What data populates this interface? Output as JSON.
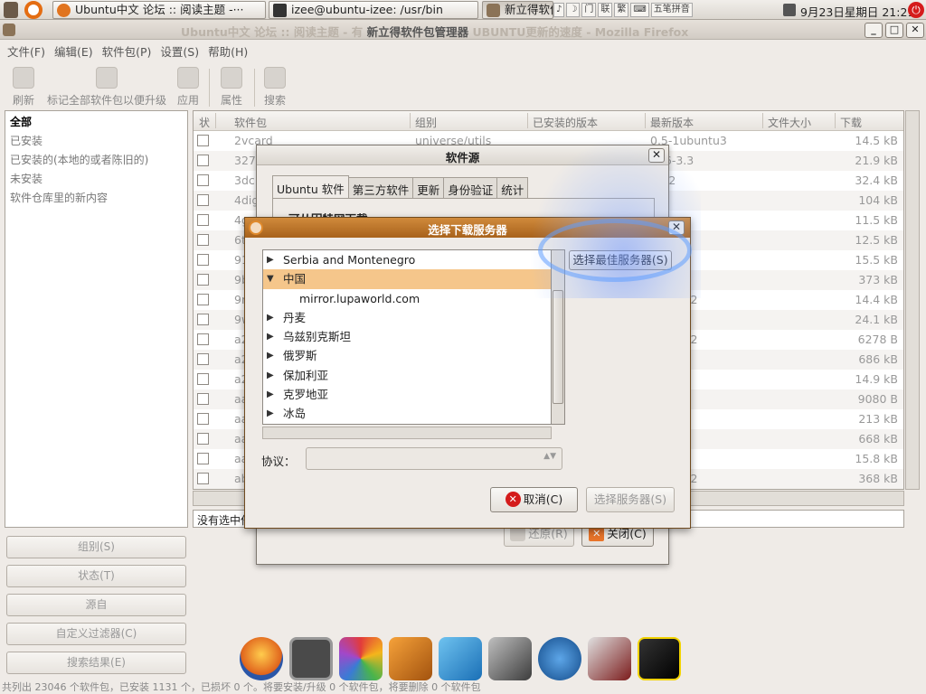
{
  "panel": {
    "tasks": [
      {
        "label": "Ubuntu中文 论坛 :: 阅读主题 -···"
      },
      {
        "label": "izee@ubuntu-izee: /usr/bin"
      },
      {
        "label": "新立得软件"
      }
    ],
    "tray": [
      "♪",
      "☽",
      "门",
      "联",
      "繁",
      "⌨",
      "五笔拼音"
    ],
    "clock": "9月23日星期日 21:21"
  },
  "window": {
    "title_faded_left": "Ubuntu中文 论坛 :: 阅读主题 - 有",
    "title": "新立得软件包管理器",
    "title_faded_right": "UBUNTU更新的速度 - Mozilla Firefox",
    "controls": [
      "_",
      "□",
      "✕"
    ]
  },
  "menubar": [
    "文件(F)",
    "编辑(E)",
    "软件包(P)",
    "设置(S)",
    "帮助(H)"
  ],
  "toolbar": {
    "reload": "刷新",
    "mark_all": "标记全部软件包以便升级",
    "apply": "应用",
    "properties": "属性",
    "search": "搜索"
  },
  "filters": [
    "全部",
    "已安装",
    "已安装的(本地的或者陈旧的)",
    "未安装",
    "软件仓库里的新内容"
  ],
  "side_buttons": [
    "组别(S)",
    "状态(T)",
    "源自",
    "自定义过滤器(C)",
    "搜索结果(E)"
  ],
  "table": {
    "columns": [
      "状",
      "软件包",
      "组别",
      "已安装的版本",
      "最新版本",
      "文件大小",
      "下载"
    ],
    "rows": [
      {
        "pkg": "2vcard",
        "group": "universe/utils",
        "latest": "0.5-1ubuntu3",
        "size": "14.5 kB"
      },
      {
        "pkg": "327",
        "group": "",
        "latest": "4p6-3.3",
        "size": "21.9 kB"
      },
      {
        "pkg": "3dc",
        "group": "",
        "latest": "1-12",
        "size": "32.4 kB"
      },
      {
        "pkg": "4dig",
        "group": "",
        "latest": "",
        "size": "104 kB"
      },
      {
        "pkg": "4g",
        "group": "",
        "latest": "",
        "size": "11.5 kB"
      },
      {
        "pkg": "6t",
        "group": "",
        "latest": "2",
        "size": "12.5 kB"
      },
      {
        "pkg": "91",
        "group": "",
        "latest": "buntu1",
        "size": "15.5 kB"
      },
      {
        "pkg": "9b",
        "group": "",
        "latest": "01-2",
        "size": "373 kB"
      },
      {
        "pkg": "9m",
        "group": "",
        "latest": "ubuntu2",
        "size": "14.4 kB"
      },
      {
        "pkg": "9w",
        "group": "",
        "latest": "",
        "size": "24.1 kB"
      },
      {
        "pkg": "a2",
        "group": "",
        "latest": "ubuntu2",
        "size": "6278  B"
      },
      {
        "pkg": "a2",
        "group": "",
        "latest": "~rc5-1",
        "size": "686 kB"
      },
      {
        "pkg": "a2",
        "group": "",
        "latest": "",
        "size": "14.9 kB"
      },
      {
        "pkg": "aa",
        "group": "",
        "latest": "",
        "size": "9080  B"
      },
      {
        "pkg": "aa",
        "group": "",
        "latest": "1",
        "size": "213 kB"
      },
      {
        "pkg": "aa",
        "group": "",
        "latest": "1",
        "size": "668 kB"
      },
      {
        "pkg": "aa",
        "group": "",
        "latest": "",
        "size": "15.8 kB"
      },
      {
        "pkg": "ab",
        "group": "",
        "latest": "ubuntu2",
        "size": "368 kB"
      }
    ]
  },
  "details_text": "没有选中任",
  "status_text": "共列出 23046 个软件包，已安装 1131 个，已损坏 0 个。将要安装/升级 0 个软件包，将要删除 0 个软件包",
  "sources_dialog": {
    "title": "软件源",
    "tabs": [
      "Ubuntu 软件",
      "第三方软件",
      "更新",
      "身份验证",
      "统计"
    ],
    "heading": "可从因特网下载",
    "revert": "还原(R)",
    "close": "关闭(C)"
  },
  "server_dialog": {
    "title": "选择下载服务器",
    "countries": [
      {
        "label": "Serbia and Montenegro",
        "expanded": false
      },
      {
        "label": "中国",
        "expanded": true
      },
      {
        "label": "mirror.lupaworld.com",
        "child": true
      },
      {
        "label": "丹麦",
        "expanded": false
      },
      {
        "label": "乌兹别克斯坦",
        "expanded": false
      },
      {
        "label": "俄罗斯",
        "expanded": false
      },
      {
        "label": "保加利亚",
        "expanded": false
      },
      {
        "label": "克罗地亚",
        "expanded": false
      },
      {
        "label": "冰岛",
        "expanded": false
      }
    ],
    "best_server": "选择最佳服务器(S)",
    "protocol_label": "协议：",
    "cancel": "取消(C)",
    "choose": "选择服务器(S)"
  },
  "dock": [
    "firefox-icon",
    "terminal-icon",
    "color-fan-icon",
    "box-icon",
    "network-icon",
    "media-icon",
    "wolf-icon",
    "drive-icon",
    "moto-icon"
  ]
}
